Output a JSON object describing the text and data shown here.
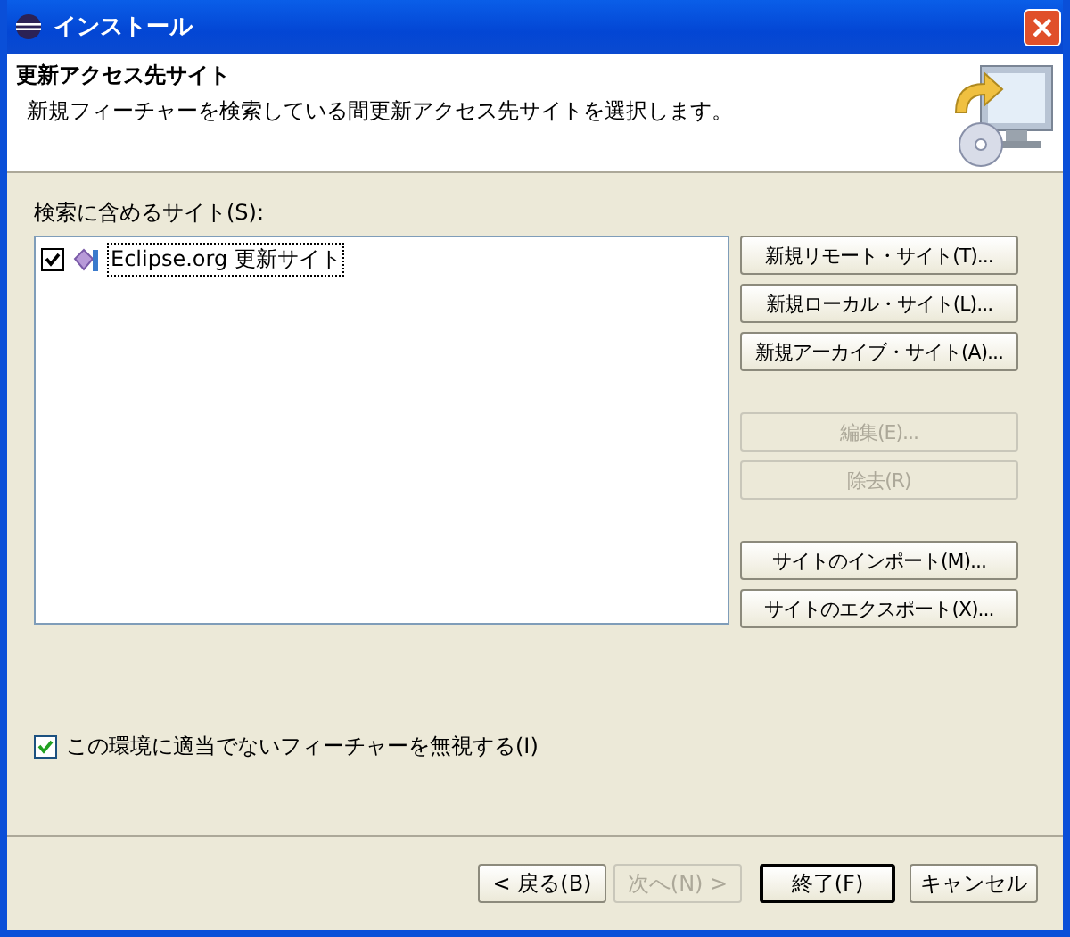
{
  "window": {
    "title": "インストール"
  },
  "header": {
    "title": "更新アクセス先サイト",
    "description": "新規フィーチャーを検索している間更新アクセス先サイトを選択します。"
  },
  "sites_label": "検索に含めるサイト(S):",
  "sites": [
    {
      "label": "Eclipse.org 更新サイト",
      "checked": true,
      "selected": true
    }
  ],
  "site_button_groups": [
    {
      "buttons": [
        {
          "label": "新規リモート・サイト(T)...",
          "disabled": false
        },
        {
          "label": "新規ローカル・サイト(L)...",
          "disabled": false
        },
        {
          "label": "新規アーカイブ・サイト(A)...",
          "disabled": false
        }
      ]
    },
    {
      "buttons": [
        {
          "label": "編集(E)...",
          "disabled": true
        },
        {
          "label": "除去(R)",
          "disabled": true
        }
      ]
    },
    {
      "buttons": [
        {
          "label": "サイトのインポート(M)...",
          "disabled": false
        },
        {
          "label": "サイトのエクスポート(X)...",
          "disabled": false
        }
      ]
    }
  ],
  "ignore_option": {
    "label": "この環境に適当でないフィーチャーを無視する(I)",
    "checked": true
  },
  "footer_buttons": [
    {
      "label": "< 戻る(B)",
      "disabled": false,
      "default": false
    },
    {
      "label": "次へ(N) >",
      "disabled": true,
      "default": false
    },
    {
      "label": "終了(F)",
      "disabled": false,
      "default": true
    },
    {
      "label": "キャンセル",
      "disabled": false,
      "default": false
    }
  ]
}
